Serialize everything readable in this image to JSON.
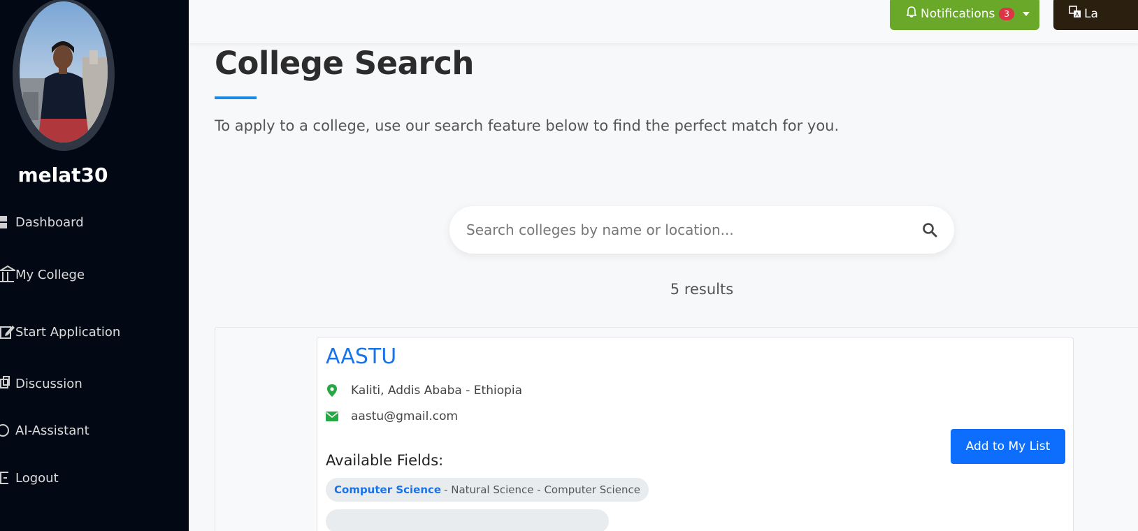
{
  "sidebar": {
    "username": "melat30",
    "items": [
      {
        "label": "Dashboard",
        "icon": "dashboard-icon"
      },
      {
        "label": "My College",
        "icon": "institution-icon"
      },
      {
        "label": "Start Application",
        "icon": "edit-icon"
      },
      {
        "label": "Discussion",
        "icon": "discussion-icon"
      },
      {
        "label": "AI-Assistant",
        "icon": "ai-icon"
      },
      {
        "label": "Logout",
        "icon": "logout-icon"
      }
    ]
  },
  "topbar": {
    "notifications_label": "Notifications",
    "notifications_count": "3",
    "language_label": "La"
  },
  "main": {
    "title": "College Search",
    "subtitle": "To apply to a college, use our search feature below to find the perfect match for you.",
    "search_placeholder": "Search colleges by name or location...",
    "results_text": "5 results"
  },
  "card": {
    "name": "AASTU",
    "location": "Kaliti, Addis Ababa - Ethiopia",
    "email": "aastu@gmail.com",
    "fields_heading": "Available Fields:",
    "field_name": "Computer Science",
    "field_detail": "- Natural Science - Computer Science",
    "add_button": "Add to My List"
  },
  "colors": {
    "sidebar_bg": "#030914",
    "notifications_green": "#6aa82a",
    "primary_blue": "#0d6efd",
    "badge_red": "#dc3545",
    "icon_green": "#28a745"
  }
}
